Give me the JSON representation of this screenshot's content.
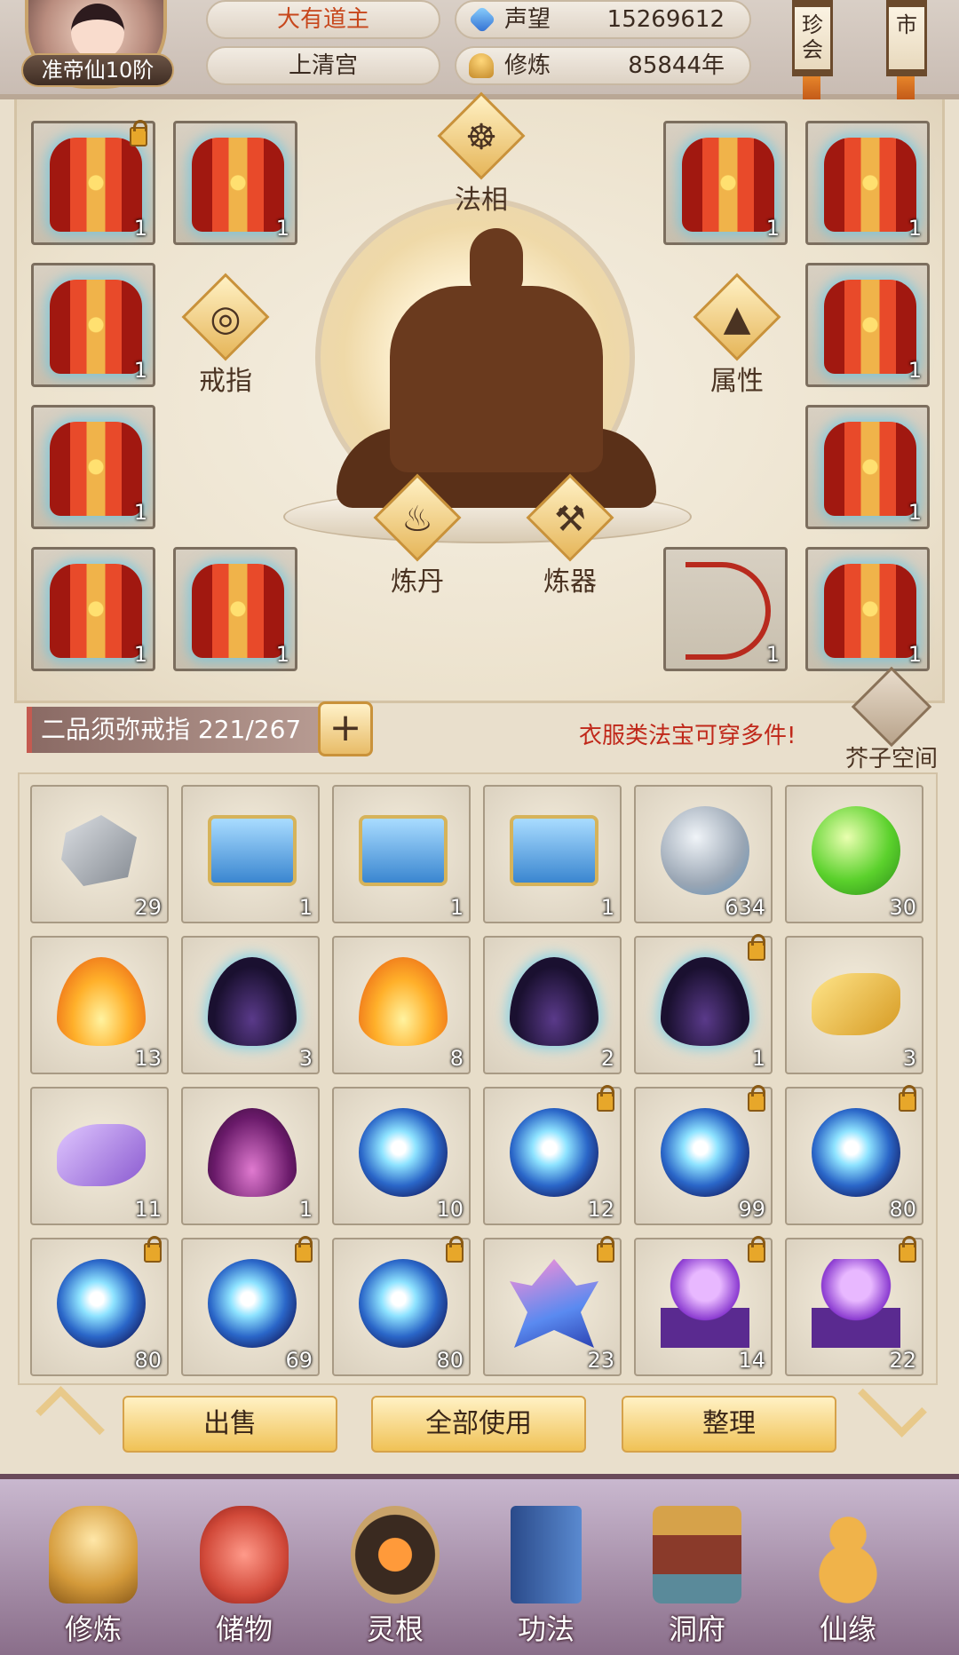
{
  "header": {
    "rank": "准帝仙10阶",
    "player_name": "大有道主",
    "sect": "上清宫",
    "reputation_label": "声望",
    "reputation_value": "15269612",
    "cultivation_label": "修炼",
    "cultivation_value": "85844年",
    "scroll_left": "珍会",
    "scroll_right": "市"
  },
  "equipment": {
    "slots": [
      {
        "icon": "red-robe-icon",
        "count": "1",
        "locked": true
      },
      {
        "icon": "red-robe-icon",
        "count": "1",
        "locked": false
      },
      {
        "icon": "red-robe-icon",
        "count": "1",
        "locked": false
      },
      {
        "icon": "red-robe-icon",
        "count": "1",
        "locked": false
      },
      {
        "icon": "red-robe-icon",
        "count": "1",
        "locked": false
      },
      {
        "icon": "red-robe-icon",
        "count": "1",
        "locked": false
      },
      {
        "icon": "red-robe-icon",
        "count": "1",
        "locked": false
      },
      {
        "icon": "red-robe-icon",
        "count": "1",
        "locked": false
      },
      {
        "icon": "red-robe-icon",
        "count": "1",
        "locked": false
      },
      {
        "icon": "red-robe-icon",
        "count": "1",
        "locked": false
      },
      {
        "icon": "bow-icon",
        "count": "1",
        "locked": false
      },
      {
        "icon": "red-robe-icon",
        "count": "1",
        "locked": false
      }
    ],
    "buttons": {
      "faxiang": "法相",
      "ring": "戒指",
      "attributes": "属性",
      "alchemy": "炼丹",
      "forging": "炼器"
    }
  },
  "ring_bar": {
    "label": "二品须弥戒指 221/267",
    "add": "+",
    "hint": "衣服类法宝可穿多件!",
    "space_button": "芥子空间"
  },
  "bag": {
    "items": [
      {
        "icon": "ore-shards-icon",
        "count": "29",
        "locked": false
      },
      {
        "icon": "blue-chest-icon",
        "count": "1",
        "locked": false
      },
      {
        "icon": "blue-chest-icon",
        "count": "1",
        "locked": false
      },
      {
        "icon": "blue-chest-icon",
        "count": "1",
        "locked": false
      },
      {
        "icon": "grey-orb-icon",
        "count": "634",
        "locked": false
      },
      {
        "icon": "green-orb-icon",
        "count": "30",
        "locked": false
      },
      {
        "icon": "fire-icon",
        "count": "13",
        "locked": false
      },
      {
        "icon": "dark-flame-icon",
        "count": "3",
        "locked": false
      },
      {
        "icon": "fire-icon",
        "count": "8",
        "locked": false
      },
      {
        "icon": "dark-flame-icon",
        "count": "2",
        "locked": false
      },
      {
        "icon": "dark-flame-icon",
        "count": "1",
        "locked": true
      },
      {
        "icon": "gold-cloud-icon",
        "count": "3",
        "locked": false
      },
      {
        "icon": "purple-cloud-icon",
        "count": "11",
        "locked": false
      },
      {
        "icon": "purple-flame-icon",
        "count": "1",
        "locked": false
      },
      {
        "icon": "blue-orb-icon",
        "count": "10",
        "locked": false
      },
      {
        "icon": "blue-orb-icon",
        "count": "12",
        "locked": true
      },
      {
        "icon": "blue-orb-icon",
        "count": "99",
        "locked": true
      },
      {
        "icon": "blue-orb-icon",
        "count": "80",
        "locked": true
      },
      {
        "icon": "blue-orb-icon",
        "count": "80",
        "locked": true
      },
      {
        "icon": "blue-orb-icon",
        "count": "69",
        "locked": true
      },
      {
        "icon": "blue-orb-icon",
        "count": "80",
        "locked": true
      },
      {
        "icon": "crystal-icon",
        "count": "23",
        "locked": true
      },
      {
        "icon": "purple-pedestal-icon",
        "count": "14",
        "locked": true
      },
      {
        "icon": "purple-pedestal-icon",
        "count": "22",
        "locked": true
      }
    ]
  },
  "actions": {
    "sell": "出售",
    "use_all": "全部使用",
    "organize": "整理"
  },
  "nav": [
    {
      "label": "修炼",
      "icon": "monk-icon"
    },
    {
      "label": "储物",
      "icon": "bag-icon"
    },
    {
      "label": "灵根",
      "icon": "spirit-root-icon"
    },
    {
      "label": "功法",
      "icon": "book-icon"
    },
    {
      "label": "洞府",
      "icon": "cave-house-icon"
    },
    {
      "label": "仙缘",
      "icon": "gourd-icon"
    }
  ]
}
